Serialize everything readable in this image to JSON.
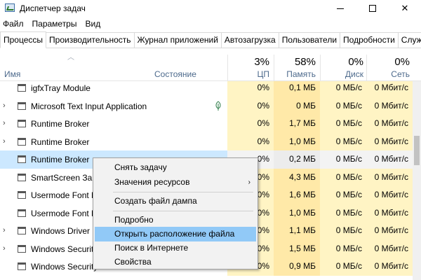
{
  "window": {
    "title": "Диспетчер задач",
    "controls": {
      "minimize": "",
      "maximize": "",
      "close": "✕"
    }
  },
  "menu": [
    "Файл",
    "Параметры",
    "Вид"
  ],
  "tabs": [
    {
      "label": "Процессы",
      "active": true
    },
    {
      "label": "Производительность"
    },
    {
      "label": "Журнал приложений"
    },
    {
      "label": "Автозагрузка"
    },
    {
      "label": "Пользователи"
    },
    {
      "label": "Подробности"
    },
    {
      "label": "Службы"
    }
  ],
  "columns": {
    "name": "Имя",
    "status": "Состояние",
    "cpu": {
      "pct": "3%",
      "label": "ЦП"
    },
    "memory": {
      "pct": "58%",
      "label": "Память"
    },
    "disk": {
      "pct": "0%",
      "label": "Диск"
    },
    "network": {
      "pct": "0%",
      "label": "Сеть"
    }
  },
  "processes": [
    {
      "name": "igfxTray Module",
      "expand": "",
      "cpu": "0%",
      "mem": "0,1 МБ",
      "disk": "0 МБ/с",
      "net": "0 Мбит/с"
    },
    {
      "name": "Microsoft Text Input Application",
      "expand": "›",
      "leaf": true,
      "cpu": "0%",
      "mem": "0 МБ",
      "disk": "0 МБ/с",
      "net": "0 Мбит/с"
    },
    {
      "name": "Runtime Broker",
      "expand": "›",
      "cpu": "0%",
      "mem": "1,7 МБ",
      "disk": "0 МБ/с",
      "net": "0 Мбит/с"
    },
    {
      "name": "Runtime Broker",
      "expand": "›",
      "cpu": "0%",
      "mem": "1,0 МБ",
      "disk": "0 МБ/с",
      "net": "0 Мбит/с"
    },
    {
      "name": "Runtime Broker",
      "expand": "",
      "selected": true,
      "cpu": "0%",
      "mem": "0,2 МБ",
      "disk": "0 МБ/с",
      "net": "0 Мбит/с"
    },
    {
      "name": "SmartScreen Защ",
      "expand": "",
      "cpu": "0%",
      "mem": "4,3 МБ",
      "disk": "0 МБ/с",
      "net": "0 Мбит/с"
    },
    {
      "name": "Usermode Font D",
      "expand": "",
      "cpu": "0%",
      "mem": "1,6 МБ",
      "disk": "0 МБ/с",
      "net": "0 Мбит/с"
    },
    {
      "name": "Usermode Font D",
      "expand": "",
      "cpu": "0%",
      "mem": "1,0 МБ",
      "disk": "0 МБ/с",
      "net": "0 Мбит/с"
    },
    {
      "name": "Windows Driver F",
      "expand": "›",
      "cpu": "0%",
      "mem": "1,1 МБ",
      "disk": "0 МБ/с",
      "net": "0 Мбит/с"
    },
    {
      "name": "Windows Security",
      "expand": "›",
      "cpu": "0%",
      "mem": "1,5 МБ",
      "disk": "0 МБ/с",
      "net": "0 Мбит/с"
    },
    {
      "name": "Windows Security",
      "expand": "",
      "cpu": "0%",
      "mem": "0,9 МБ",
      "disk": "0 МБ/с",
      "net": "0 Мбит/с"
    }
  ],
  "context_menu": {
    "items": [
      {
        "label": "Снять задачу"
      },
      {
        "label": "Значения ресурсов",
        "submenu": "›"
      },
      {
        "label": "Создать файл дампа"
      },
      {
        "label": "Подробно"
      },
      {
        "label": "Открыть расположение файла",
        "hover": true
      },
      {
        "label": "Поиск в Интернете"
      },
      {
        "label": "Свойства"
      }
    ]
  },
  "colors": {
    "heat_light": "#fff4c4",
    "heat_mem": "#ffe9a8",
    "selection": "#cce8ff",
    "menu_hover": "#91c9f7"
  }
}
